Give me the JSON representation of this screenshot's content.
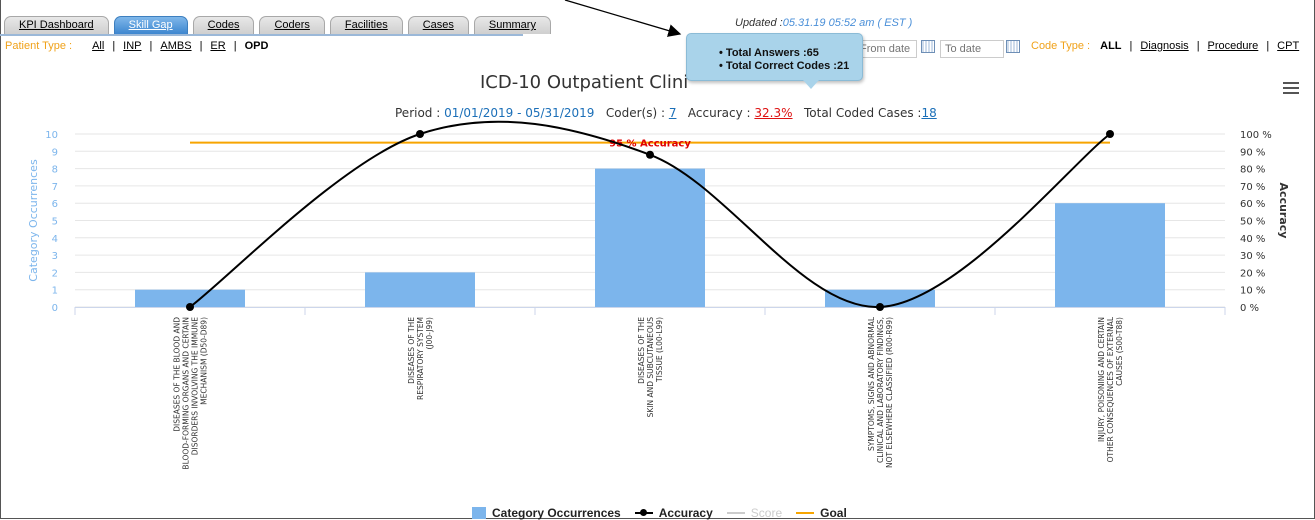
{
  "tabs": [
    {
      "label": "KPI Dashboard",
      "active": false
    },
    {
      "label": "Skill Gap",
      "active": true
    },
    {
      "label": "Codes",
      "active": false
    },
    {
      "label": "Coders",
      "active": false
    },
    {
      "label": "Facilities",
      "active": false
    },
    {
      "label": "Cases",
      "active": false
    },
    {
      "label": "Summary",
      "active": false
    }
  ],
  "updated": {
    "prefix": "Updated :",
    "timestamp": "05.31.19 05:52 am ( EST )"
  },
  "patient_filter": {
    "label": "Patient Type :",
    "options": [
      {
        "label": "All",
        "selected": false
      },
      {
        "label": "INP",
        "selected": false
      },
      {
        "label": "AMBS",
        "selected": false
      },
      {
        "label": "ER",
        "selected": false
      },
      {
        "label": "OPD",
        "selected": true
      }
    ]
  },
  "date_range": {
    "from_placeholder": "From date",
    "to_placeholder": "To date"
  },
  "code_type": {
    "label": "Code Type :",
    "options": [
      {
        "label": "ALL",
        "selected": true
      },
      {
        "label": "Diagnosis",
        "selected": false
      },
      {
        "label": "Procedure",
        "selected": false
      },
      {
        "label": "CPT",
        "selected": false
      }
    ]
  },
  "tooltip": {
    "total_answers": "Total Answers :65",
    "total_correct": "Total Correct Codes :21"
  },
  "summary": {
    "period_label": "Period :",
    "period_value": "01/01/2019 - 05/31/2019",
    "coders_label": "Coder(s) :",
    "coders_value": "7",
    "accuracy_label": "Accuracy :",
    "accuracy_value": "32.3%",
    "cases_label": "Total Coded Cases :",
    "cases_value": "18"
  },
  "menu_icon": "hamburger-icon",
  "colors": {
    "bar": "#7cb5ec",
    "accuracy": "#000000",
    "goal": "#f7a500",
    "goal_label": "#e00000",
    "left_axis": "#7cb5ec"
  },
  "chart_data": {
    "type": "bar",
    "title": "ICD-10 Outpatient Clini",
    "categories": [
      [
        "DISEASES OF THE BLOOD AND",
        "BLOOD-FORMING ORGANS AND CERTAIN",
        "DISORDERS INVOLVING THE IMMUNE",
        "MECHANISM (D50-D89)"
      ],
      [
        "DISEASES OF THE",
        "RESPIRATORY SYSTEM",
        "(J00-J99)"
      ],
      [
        "DISEASES OF THE",
        "SKIN AND SUBCUTANEOUS",
        "TISSUE (L00-L99)"
      ],
      [
        "SYMPTOMS, SIGNS AND ABNORMAL",
        "CLINICAL AND LABORATORY FINDINGS,",
        "NOT ELSEWHERE CLASSIFIED (R00-R99)"
      ],
      [
        "INJURY, POISONING AND CERTAIN",
        "OTHER CONSEQUENCES OF EXTERNAL",
        "CAUSES (S00-T88)"
      ]
    ],
    "series": [
      {
        "name": "Category Occurrences",
        "type": "bar",
        "axis": "left",
        "values": [
          1,
          2,
          8,
          1,
          6
        ]
      },
      {
        "name": "Accuracy",
        "type": "spline",
        "axis": "right",
        "values": [
          0,
          100,
          88,
          0,
          100
        ]
      },
      {
        "name": "Score",
        "type": "line",
        "visible": false,
        "values": []
      },
      {
        "name": "Goal",
        "type": "line",
        "axis": "right",
        "values": [
          95,
          95,
          95,
          95,
          95
        ]
      }
    ],
    "goal_label": "95 % Accuracy",
    "ylabel_left": "Category Occurrences",
    "ylabel_right": "Accuracy",
    "ylim_left": [
      0,
      10
    ],
    "ylim_right": [
      0,
      100
    ],
    "yticks_left": [
      "0",
      "1",
      "2",
      "3",
      "4",
      "5",
      "6",
      "7",
      "8",
      "9",
      "10"
    ],
    "yticks_right": [
      "0 %",
      "10 %",
      "20 %",
      "30 %",
      "40 %",
      "50 %",
      "60 %",
      "70 %",
      "80 %",
      "90 %",
      "100 %"
    ],
    "grid": true,
    "legend_position": "bottom"
  }
}
